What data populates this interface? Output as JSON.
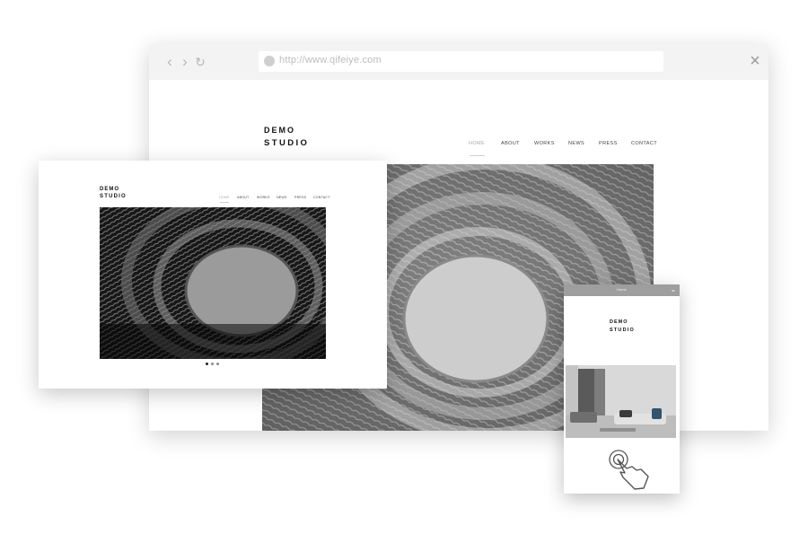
{
  "browser": {
    "url": "http://www.qifeiye.com",
    "icons": {
      "back": "chevron-left-icon",
      "forward": "chevron-right-icon",
      "reload": "reload-icon",
      "site": "globe-icon",
      "close": "close-icon"
    }
  },
  "desktop_site": {
    "logo_line1": "DEMO",
    "logo_line2": "STUDIO",
    "nav": [
      "HOME",
      "ABOUT",
      "WORKS",
      "NEWS",
      "PRESS",
      "CONTACT"
    ],
    "active_nav": "HOME"
  },
  "tablet_site": {
    "logo_line1": "DEMO",
    "logo_line2": "STUDIO",
    "nav": [
      "HOME",
      "ABOUT",
      "WORKS",
      "NEWS",
      "PRESS",
      "CONTACT"
    ],
    "active_nav": "HOME",
    "slider_dots": 3,
    "active_slide": 1
  },
  "mobile_site": {
    "menu_label": "Home",
    "logo_line1": "DEMO",
    "logo_line2": "STUDIO",
    "icons": {
      "menu": "chevron-down-icon",
      "gesture": "hand-touch-icon"
    }
  },
  "colors": {
    "accent": "#111111",
    "chrome": "#f3f3f3",
    "mobile_bar": "#9e9e9e"
  }
}
